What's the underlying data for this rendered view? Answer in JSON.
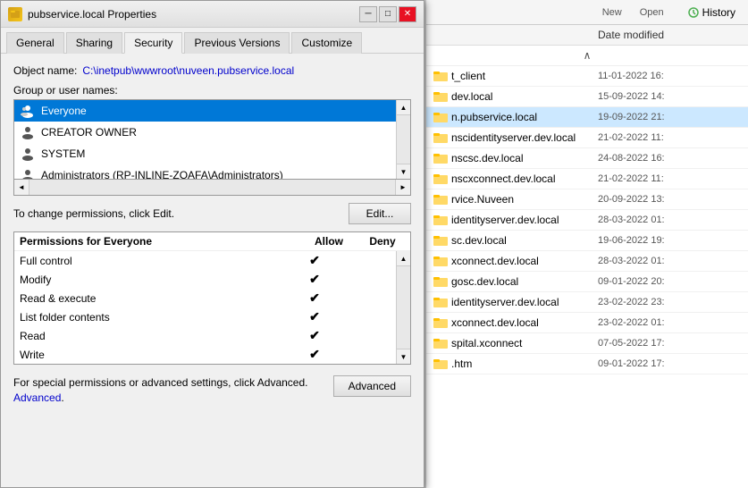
{
  "dialog": {
    "title": "pubservice.local Properties",
    "title_icon": "folder",
    "close_btn": "✕",
    "minimize_btn": "─",
    "maximize_btn": "□"
  },
  "tabs": [
    {
      "label": "General",
      "active": false
    },
    {
      "label": "Sharing",
      "active": false
    },
    {
      "label": "Security",
      "active": true
    },
    {
      "label": "Previous Versions",
      "active": false
    },
    {
      "label": "Customize",
      "active": false
    }
  ],
  "security": {
    "object_name_label": "Object name:",
    "object_name_value": "C:\\inetpub\\wwwroot\\nuveen.pubservice.local",
    "group_label": "Group or user names:",
    "users": [
      {
        "name": "Everyone",
        "selected": true
      },
      {
        "name": "CREATOR OWNER",
        "selected": false
      },
      {
        "name": "SYSTEM",
        "selected": false
      },
      {
        "name": "Administrators (RP-INLINE-ZOAFA\\Administrators)",
        "selected": false
      }
    ],
    "permissions_note": "To change permissions, click Edit.",
    "edit_btn": "Edit...",
    "permissions_header": "Permissions for Everyone",
    "allow_label": "Allow",
    "deny_label": "Deny",
    "permissions": [
      {
        "name": "Full control",
        "allow": true,
        "deny": false
      },
      {
        "name": "Modify",
        "allow": true,
        "deny": false
      },
      {
        "name": "Read & execute",
        "allow": true,
        "deny": false
      },
      {
        "name": "List folder contents",
        "allow": true,
        "deny": false
      },
      {
        "name": "Read",
        "allow": true,
        "deny": false
      },
      {
        "name": "Write",
        "allow": true,
        "deny": false
      }
    ],
    "advanced_note": "For special permissions or advanced settings, click Advanced.",
    "advanced_link": "Advanced",
    "advanced_btn": "Advanced"
  },
  "explorer": {
    "toolbar": {
      "new_label": "New",
      "open_label": "Open",
      "history_label": "History"
    },
    "header": {
      "date_label": "Date modified"
    },
    "files": [
      {
        "name": "t_client",
        "date": "11-01-2022 16:",
        "highlighted": false
      },
      {
        "name": "dev.local",
        "date": "15-09-2022 14:",
        "highlighted": false
      },
      {
        "name": "n.pubservice.local",
        "date": "19-09-2022 21:",
        "highlighted": true
      },
      {
        "name": "nscidentityserver.dev.local",
        "date": "21-02-2022 11:",
        "highlighted": false
      },
      {
        "name": "nscsc.dev.local",
        "date": "24-08-2022 16:",
        "highlighted": false
      },
      {
        "name": "nscxconnect.dev.local",
        "date": "21-02-2022 11:",
        "highlighted": false
      },
      {
        "name": "rvice.Nuveen",
        "date": "20-09-2022 13:",
        "highlighted": false
      },
      {
        "name": "identityserver.dev.local",
        "date": "28-03-2022 01:",
        "highlighted": false
      },
      {
        "name": "sc.dev.local",
        "date": "19-06-2022 19:",
        "highlighted": false
      },
      {
        "name": "xconnect.dev.local",
        "date": "28-03-2022 01:",
        "highlighted": false
      },
      {
        "name": "gosc.dev.local",
        "date": "09-01-2022 20:",
        "highlighted": false
      },
      {
        "name": "identityserver.dev.local",
        "date": "23-02-2022 23:",
        "highlighted": false
      },
      {
        "name": "xconnect.dev.local",
        "date": "23-02-2022 01:",
        "highlighted": false
      },
      {
        "name": "spital.xconnect",
        "date": "07-05-2022 17:",
        "highlighted": false
      },
      {
        "name": ".htm",
        "date": "09-01-2022 17:",
        "highlighted": false
      }
    ]
  }
}
